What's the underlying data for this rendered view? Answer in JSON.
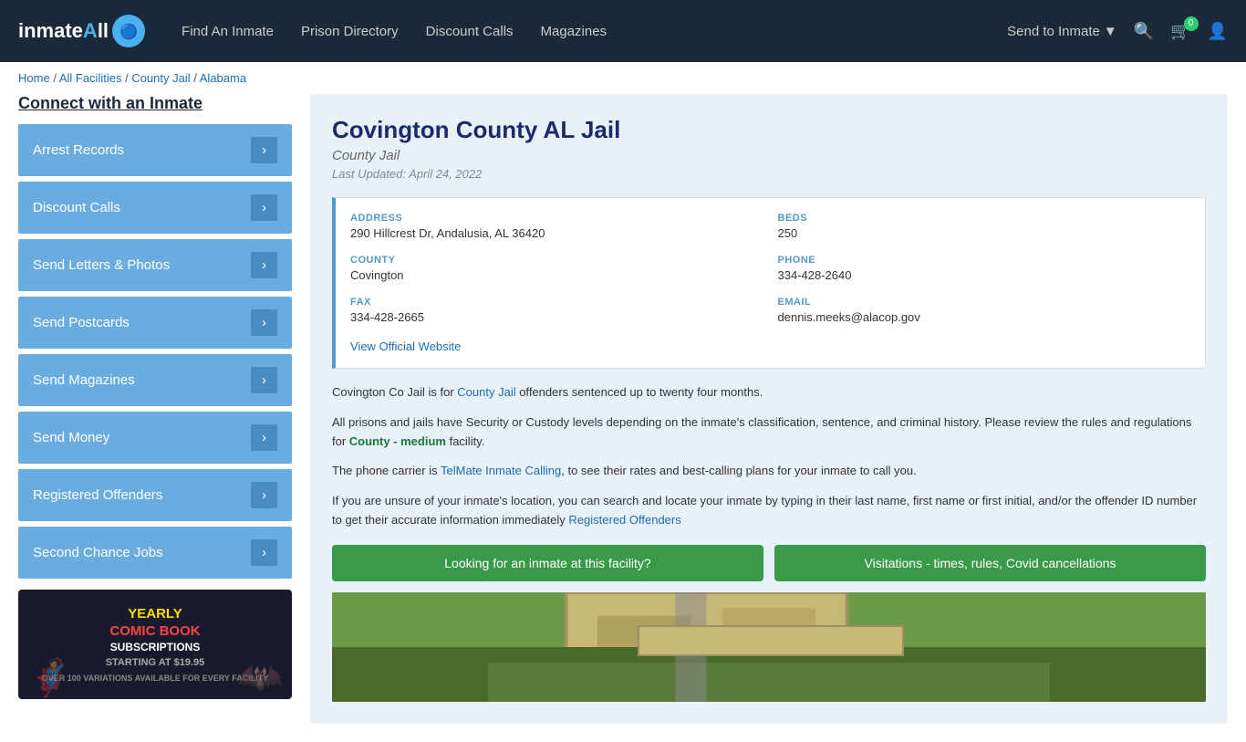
{
  "nav": {
    "logo_text": "inmateA",
    "logo_span": "ll",
    "links": [
      {
        "label": "Find An Inmate",
        "href": "#"
      },
      {
        "label": "Prison Directory",
        "href": "#"
      },
      {
        "label": "Discount Calls",
        "href": "#"
      },
      {
        "label": "Magazines",
        "href": "#"
      }
    ],
    "send_to_inmate": "Send to Inmate",
    "cart_count": "0"
  },
  "breadcrumb": {
    "items": [
      "Home",
      "All Facilities",
      "County Jail",
      "Alabama"
    ]
  },
  "sidebar": {
    "title": "Connect with an Inmate",
    "items": [
      {
        "label": "Arrest Records"
      },
      {
        "label": "Discount Calls"
      },
      {
        "label": "Send Letters & Photos"
      },
      {
        "label": "Send Postcards"
      },
      {
        "label": "Send Magazines"
      },
      {
        "label": "Send Money"
      },
      {
        "label": "Registered Offenders"
      },
      {
        "label": "Second Chance Jobs"
      }
    ],
    "ad": {
      "line1": "YEARLY",
      "line2": "COMIC BOOK",
      "line3": "SUBSCRIPTIONS",
      "line4": "STARTING AT $19.95",
      "line5": "OVER 100 VARIATIONS AVAILABLE FOR EVERY FACILITY"
    }
  },
  "facility": {
    "name": "Covington County AL Jail",
    "type": "County Jail",
    "last_updated": "Last Updated: April 24, 2022",
    "address_label": "ADDRESS",
    "address_value": "290 Hillcrest Dr, Andalusia, AL 36420",
    "beds_label": "BEDS",
    "beds_value": "250",
    "county_label": "COUNTY",
    "county_value": "Covington",
    "phone_label": "PHONE",
    "phone_value": "334-428-2640",
    "fax_label": "FAX",
    "fax_value": "334-428-2665",
    "email_label": "EMAIL",
    "email_value": "dennis.meeks@alacop.gov",
    "website_label": "View Official Website",
    "website_href": "#",
    "desc1": "Covington Co Jail is for County Jail offenders sentenced up to twenty four months.",
    "desc2": "All prisons and jails have Security or Custody levels depending on the inmate's classification, sentence, and criminal history. Please review the rules and regulations for County - medium facility.",
    "desc3": "The phone carrier is TelMate Inmate Calling, to see their rates and best-calling plans for your inmate to call you.",
    "desc4": "If you are unsure of your inmate's location, you can search and locate your inmate by typing in their last name, first name or first initial, and/or the offender ID number to get their accurate information immediately Registered Offenders",
    "btn1": "Looking for an inmate at this facility?",
    "btn2": "Visitations - times, rules, Covid cancellations"
  }
}
